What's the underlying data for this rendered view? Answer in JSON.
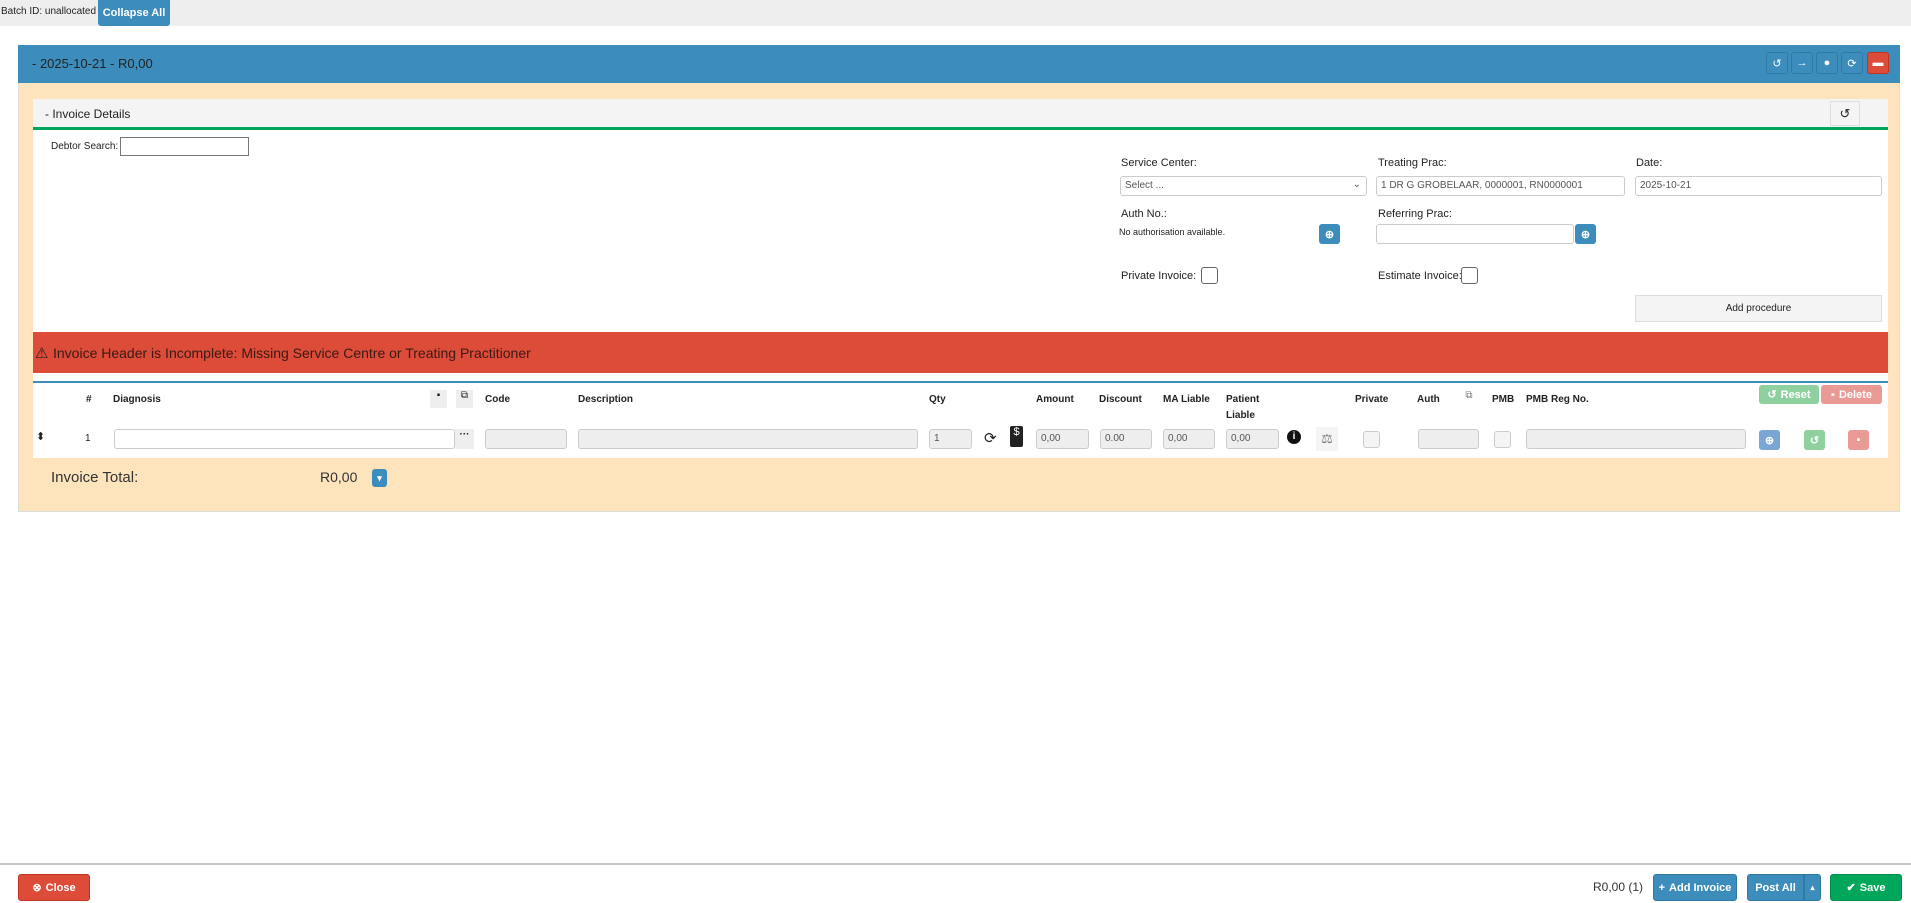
{
  "topbar": {
    "batch_label": "Batch ID: unallocated",
    "collapse_all": "Collapse All"
  },
  "invoice_card": {
    "title": "- 2025-10-21 - R0,00",
    "header_icons": [
      "history-icon",
      "arrow-right-icon",
      "user-circle-icon",
      "refresh-icon",
      "delete-icon"
    ]
  },
  "details": {
    "title": "- Invoice Details",
    "debtor_search_label": "Debtor Search:",
    "debtor_search_value": "",
    "service_center_label": "Service Center:",
    "service_center_value": "Select ...",
    "treating_prac_label": "Treating Prac:",
    "treating_prac_value": "1 DR G GROBELAAR, 0000001, RN0000001",
    "date_label": "Date:",
    "date_value": "2025-10-21",
    "auth_label": "Auth No.:",
    "auth_text": "No authorisation available.",
    "referring_label": "Referring Prac:",
    "referring_value": "",
    "private_label": "Private Invoice:",
    "estimate_label": "Estimate Invoice:",
    "add_procedure": "Add procedure"
  },
  "alert": {
    "text": "Invoice Header is Incomplete: Missing Service Centre or Treating Practitioner",
    "color": "#dd4b39"
  },
  "table": {
    "headers": {
      "num": "#",
      "diagnosis": "Diagnosis",
      "code": "Code",
      "description": "Description",
      "qty": "Qty",
      "amount": "Amount",
      "discount": "Discount",
      "ma_liable": "MA Liable",
      "patient_liable": "Patient Liable",
      "private": "Private",
      "auth": "Auth",
      "pmb": "PMB",
      "pmb_reg": "PMB Reg No.",
      "reset": "Reset",
      "delete": "Delete"
    },
    "rows": [
      {
        "num": "1",
        "diagnosis": "",
        "code": "",
        "description": "",
        "qty": "1",
        "amount": "0,00",
        "discount": "0.00",
        "ma_liable": "0,00",
        "patient_liable": "0,00",
        "auth": "",
        "pmb_reg": ""
      }
    ]
  },
  "total": {
    "label": "Invoice Total:",
    "value": "R0,00"
  },
  "footer": {
    "close": "Close",
    "summary": "R0,00 (1)",
    "add_invoice": "Add Invoice",
    "post_all": "Post All",
    "save": "Save"
  }
}
